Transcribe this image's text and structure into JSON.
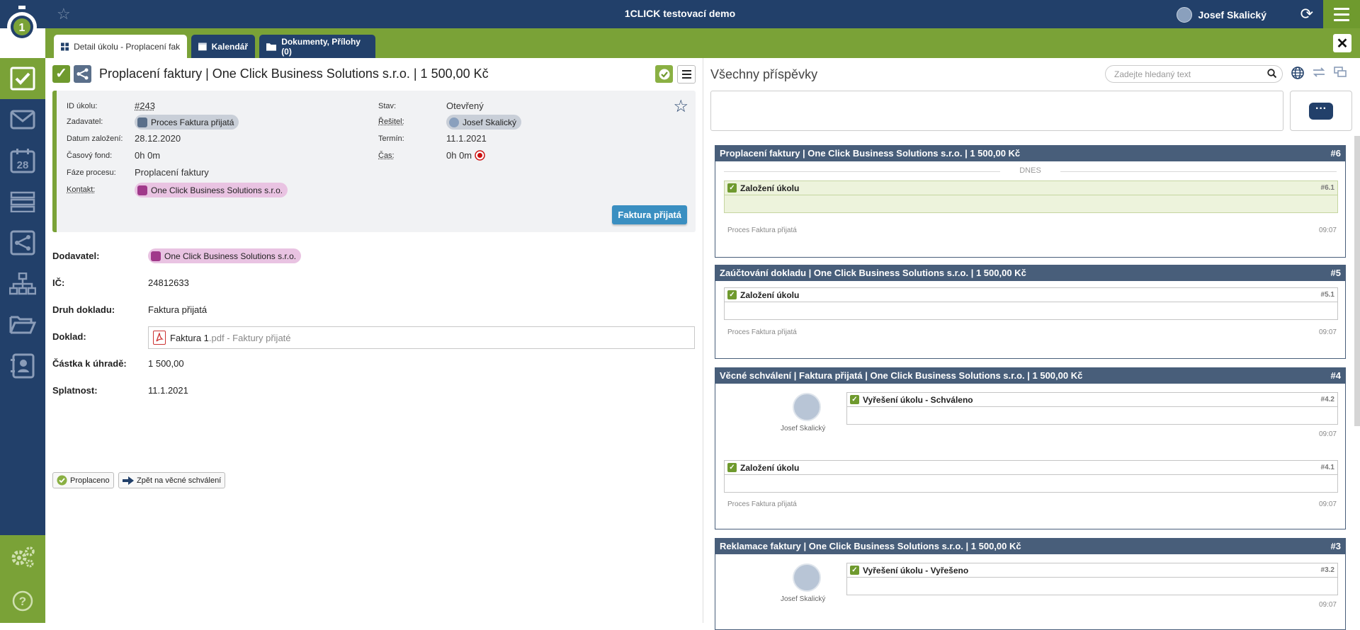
{
  "app": {
    "title": "1CLICK testovací demo",
    "user": "Josef Skalický"
  },
  "tabs": [
    {
      "label": "Detail úkolu - Proplacení faktury | ..."
    },
    {
      "label": "Kalendář"
    },
    {
      "label": "Dokumenty, Přílohy (0)"
    }
  ],
  "task": {
    "title": "Proplacení faktury | One Click Business Solutions s.r.o. | 1 500,00 Kč",
    "fields_left": [
      {
        "label": "ID úkolu:",
        "value": "#243"
      },
      {
        "label": "Zadavatel:",
        "value": "Proces Faktura přijatá"
      },
      {
        "label": "Datum založení:",
        "value": "28.12.2020"
      },
      {
        "label": "Časový fond:",
        "value": "0h 0m"
      },
      {
        "label": "Fáze procesu:",
        "value": "Proplacení faktury"
      },
      {
        "label": "Kontakt:",
        "value": "One Click Business Solutions s.r.o."
      }
    ],
    "fields_right": [
      {
        "label": "Stav:",
        "value": "Otevřený"
      },
      {
        "label": "Řešitel:",
        "value": "Josef Skalický"
      },
      {
        "label": "Termín:",
        "value": "11.1.2021"
      },
      {
        "label": "Čas:",
        "value": "0h 0m"
      }
    ],
    "process_button": "Faktura přijatá"
  },
  "form": {
    "dodavatel_label": "Dodavatel:",
    "dodavatel_value": "One Click Business Solutions s.r.o.",
    "ic_label": "IČ:",
    "ic_value": "24812633",
    "druh_label": "Druh dokladu:",
    "druh_value": "Faktura přijatá",
    "doklad_label": "Doklad:",
    "doklad_file": "Faktura 1",
    "doklad_ext": ".pdf - Faktury přijaté",
    "castka_label": "Částka k úhradě:",
    "castka_value": "1 500,00",
    "splatnost_label": "Splatnost:",
    "splatnost_value": "11.1.2021"
  },
  "actions": {
    "paid": "Proplaceno",
    "back": "Zpět na věcné schválení"
  },
  "posts": {
    "title": "Všechny příspěvky",
    "search_placeholder": "Zadejte hledaný text",
    "today": "DNES",
    "threads": [
      {
        "title": "Proplacení faktury | One Click Business Solutions s.r.o. | 1 500,00 Kč",
        "num": "#6",
        "msg": "Založení úkolu",
        "msg_num": "#6.1",
        "author": "Proces Faktura přijatá",
        "time": "09:07"
      },
      {
        "title": "Zaúčtování dokladu | One Click Business Solutions s.r.o. | 1 500,00 Kč",
        "num": "#5",
        "msg": "Založení úkolu",
        "msg_num": "#5.1",
        "author": "Proces Faktura přijatá",
        "time": "09:07"
      },
      {
        "title": "Věcné schválení | Faktura přijatá | One Click Business Solutions s.r.o. | 1 500,00 Kč",
        "num": "#4",
        "msg1": "Vyřešení úkolu - Schváleno",
        "msg1_num": "#4.2",
        "user": "Josef Skalický",
        "time1": "09:07",
        "msg2": "Založení úkolu",
        "msg2_num": "#4.1",
        "author": "Proces Faktura přijatá",
        "time2": "09:07"
      },
      {
        "title": "Reklamace faktury | One Click Business Solutions s.r.o. | 1 500,00 Kč",
        "num": "#3",
        "msg1": "Vyřešení úkolu - Vyřešeno",
        "msg1_num": "#3.2",
        "user": "Josef Skalický",
        "time1": "09:07"
      }
    ]
  },
  "colors": {
    "navy": "#22406a",
    "green": "#7aa237",
    "blue_button": "#3a8fc1",
    "thread_header": "#485e7a"
  }
}
